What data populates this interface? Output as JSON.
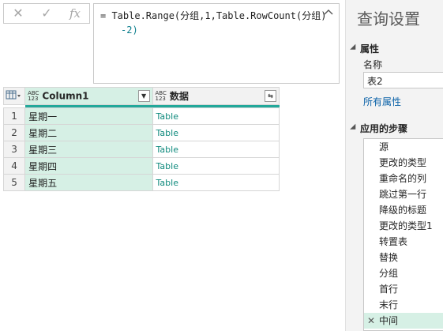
{
  "formula_bar": {
    "cancel_icon": "close-icon",
    "confirm_icon": "check-icon",
    "fx_label": "fx",
    "line1": "= Table.Range(分组,1,Table.RowCount(分组)",
    "line2": "-2)"
  },
  "grid": {
    "columns": [
      {
        "type_badge_top": "ABC",
        "type_badge_bottom": "123",
        "name": "Column1"
      },
      {
        "type_badge_top": "ABC",
        "type_badge_bottom": "123",
        "name": "数据"
      }
    ],
    "rows": [
      {
        "num": "1",
        "col1": "星期一",
        "col2": "Table"
      },
      {
        "num": "2",
        "col1": "星期二",
        "col2": "Table"
      },
      {
        "num": "3",
        "col1": "星期三",
        "col2": "Table"
      },
      {
        "num": "4",
        "col1": "星期四",
        "col2": "Table"
      },
      {
        "num": "5",
        "col1": "星期五",
        "col2": "Table"
      }
    ]
  },
  "panel": {
    "title": "查询设置",
    "properties_header": "属性",
    "name_label": "名称",
    "name_value": "表2",
    "all_properties_link": "所有属性",
    "applied_steps_header": "应用的步骤",
    "steps": [
      "源",
      "更改的类型",
      "重命名的列",
      "跳过第一行",
      "降级的标题",
      "更改的类型1",
      "转置表",
      "替换",
      "分组",
      "首行",
      "末行",
      "中间"
    ],
    "selected_step": "中间"
  },
  "colors": {
    "accent_green": "#22a89a",
    "selected_column": "#d6f0e5",
    "table_link": "#0e8a7d",
    "link_blue": "#0b62a8"
  }
}
